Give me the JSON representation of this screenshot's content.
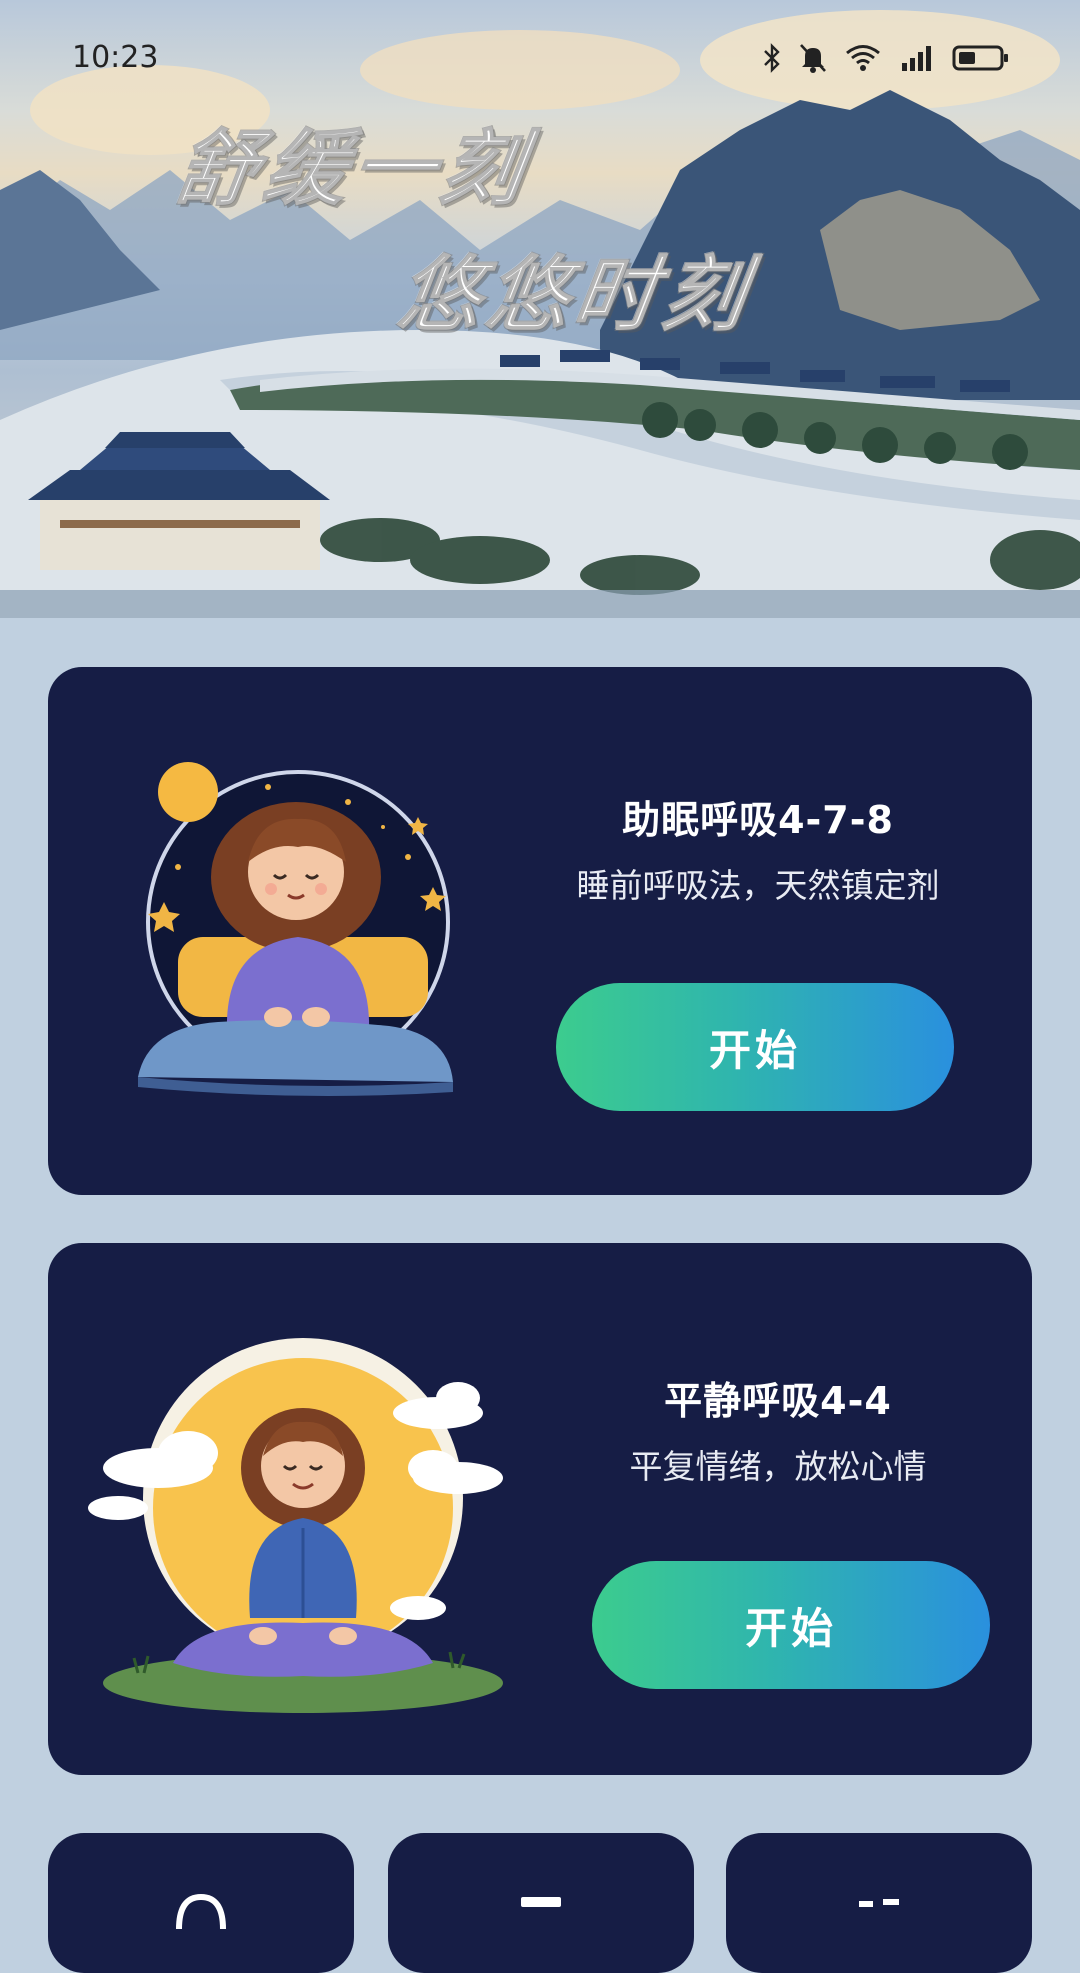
{
  "status_bar": {
    "time": "10:23",
    "icons": [
      "bluetooth-icon",
      "bell-muted-icon",
      "wifi-icon",
      "cellular-signal-icon",
      "battery-icon"
    ]
  },
  "hero": {
    "title_line1": "舒缓一刻",
    "title_line2": "悠悠时刻"
  },
  "cards": [
    {
      "title": "助眠呼吸4-7-8",
      "subtitle": "睡前呼吸法，天然镇定剂",
      "button_label": "开始",
      "illustration": "sleeping-girl-illustration"
    },
    {
      "title": "平静呼吸4-4",
      "subtitle": "平复情绪，放松心情",
      "button_label": "开始",
      "illustration": "meditating-girl-illustration"
    }
  ],
  "colors": {
    "page_background": "#c0d0e0",
    "card_background": "#161d45",
    "button_gradient_start": "#3ccc8e",
    "button_gradient_end": "#2a90de",
    "text_primary": "#ffffff"
  }
}
